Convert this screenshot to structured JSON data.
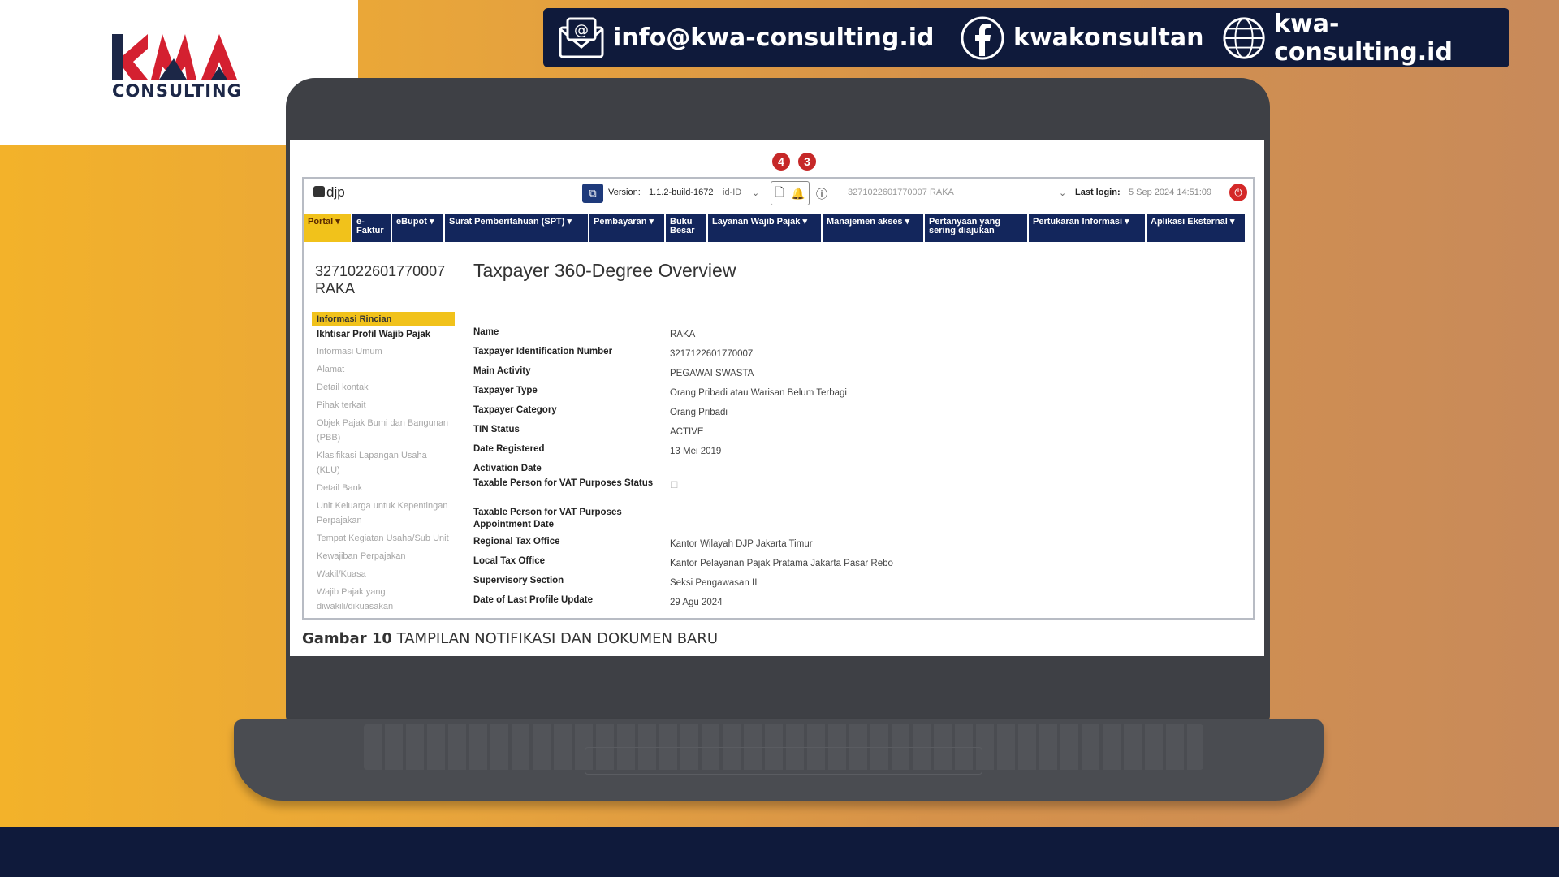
{
  "logo": {
    "text": "CONSULTING"
  },
  "contacts": {
    "email": "info@kwa-consulting.id",
    "facebook": "kwakonsultan",
    "website": "kwa-consulting.id"
  },
  "badges": {
    "doc_count": "4",
    "notif_count": "3"
  },
  "topbar": {
    "brand": "djp",
    "version_label": "Version:",
    "version_value": "1.1.2-build-1672",
    "locale": "id-ID",
    "account": "3271022601770007 RAKA",
    "last_login_label": "Last login:",
    "last_login_value": "5 Sep 2024 14:51:09"
  },
  "nav": [
    "Portal ▾",
    "e-Faktur",
    "eBupot ▾",
    "Surat Pemberitahuan (SPT) ▾",
    "Pembayaran ▾",
    "Buku Besar",
    "Layanan Wajib Pajak ▾",
    "Manajemen akses ▾",
    "Pertanyaan yang sering diajukan",
    "Pertukaran Informasi ▾",
    "Aplikasi Eksternal ▾"
  ],
  "taxpayer": {
    "id": "3271022601770007",
    "name": "RAKA"
  },
  "page_title": "Taxpayer 360-Degree Overview",
  "sidebar": {
    "header": "Informasi Rincian",
    "subheader": "Ikhtisar Profil Wajib Pajak",
    "items": [
      "Informasi Umum",
      "Alamat",
      "Detail kontak",
      "Pihak terkait",
      "Objek Pajak Bumi dan Bangunan (PBB)",
      "Klasifikasi Lapangan Usaha (KLU)",
      "Detail Bank",
      "Unit Keluarga untuk Kepentingan Perpajakan",
      "Tempat Kegiatan Usaha/Sub Unit",
      "Kewajiban Perpajakan",
      "Wakil/Kuasa",
      "Wajib Pajak yang diwakili/dikuasakan"
    ]
  },
  "fields": [
    {
      "label": "Name",
      "value": "RAKA"
    },
    {
      "label": "Taxpayer Identification Number",
      "value": "3217122601770007"
    },
    {
      "label": "Main Activity",
      "value": "PEGAWAI SWASTA"
    },
    {
      "label": "Taxpayer Type",
      "value": "Orang Pribadi atau Warisan Belum Terbagi"
    },
    {
      "label": "Taxpayer Category",
      "value": "Orang Pribadi"
    },
    {
      "label": "TIN Status",
      "value": "ACTIVE"
    },
    {
      "label": "Date Registered",
      "value": "13 Mei 2019"
    },
    {
      "label": "Activation Date",
      "value": ""
    },
    {
      "label": "Taxable Person for VAT Purposes Status",
      "value": "☐"
    },
    {
      "label": "Taxable Person for VAT Purposes Appointment Date",
      "value": ""
    },
    {
      "label": "Regional Tax Office",
      "value": "Kantor Wilayah DJP Jakarta Timur"
    },
    {
      "label": "Local Tax Office",
      "value": "Kantor Pelayanan Pajak Pratama Jakarta Pasar Rebo"
    },
    {
      "label": "Supervisory Section",
      "value": "Seksi Pengawasan II"
    },
    {
      "label": "Date of Last Profile Update",
      "value": "29 Agu 2024"
    }
  ],
  "caption": {
    "bold": "Gambar 10",
    "text": "TAMPILAN NOTIFIKASI DAN DOKUMEN BARU"
  },
  "colors": {
    "navy": "#0F1A3B",
    "nav_blue": "#13265C",
    "yellow": "#F1C21B",
    "red": "#C62828"
  }
}
